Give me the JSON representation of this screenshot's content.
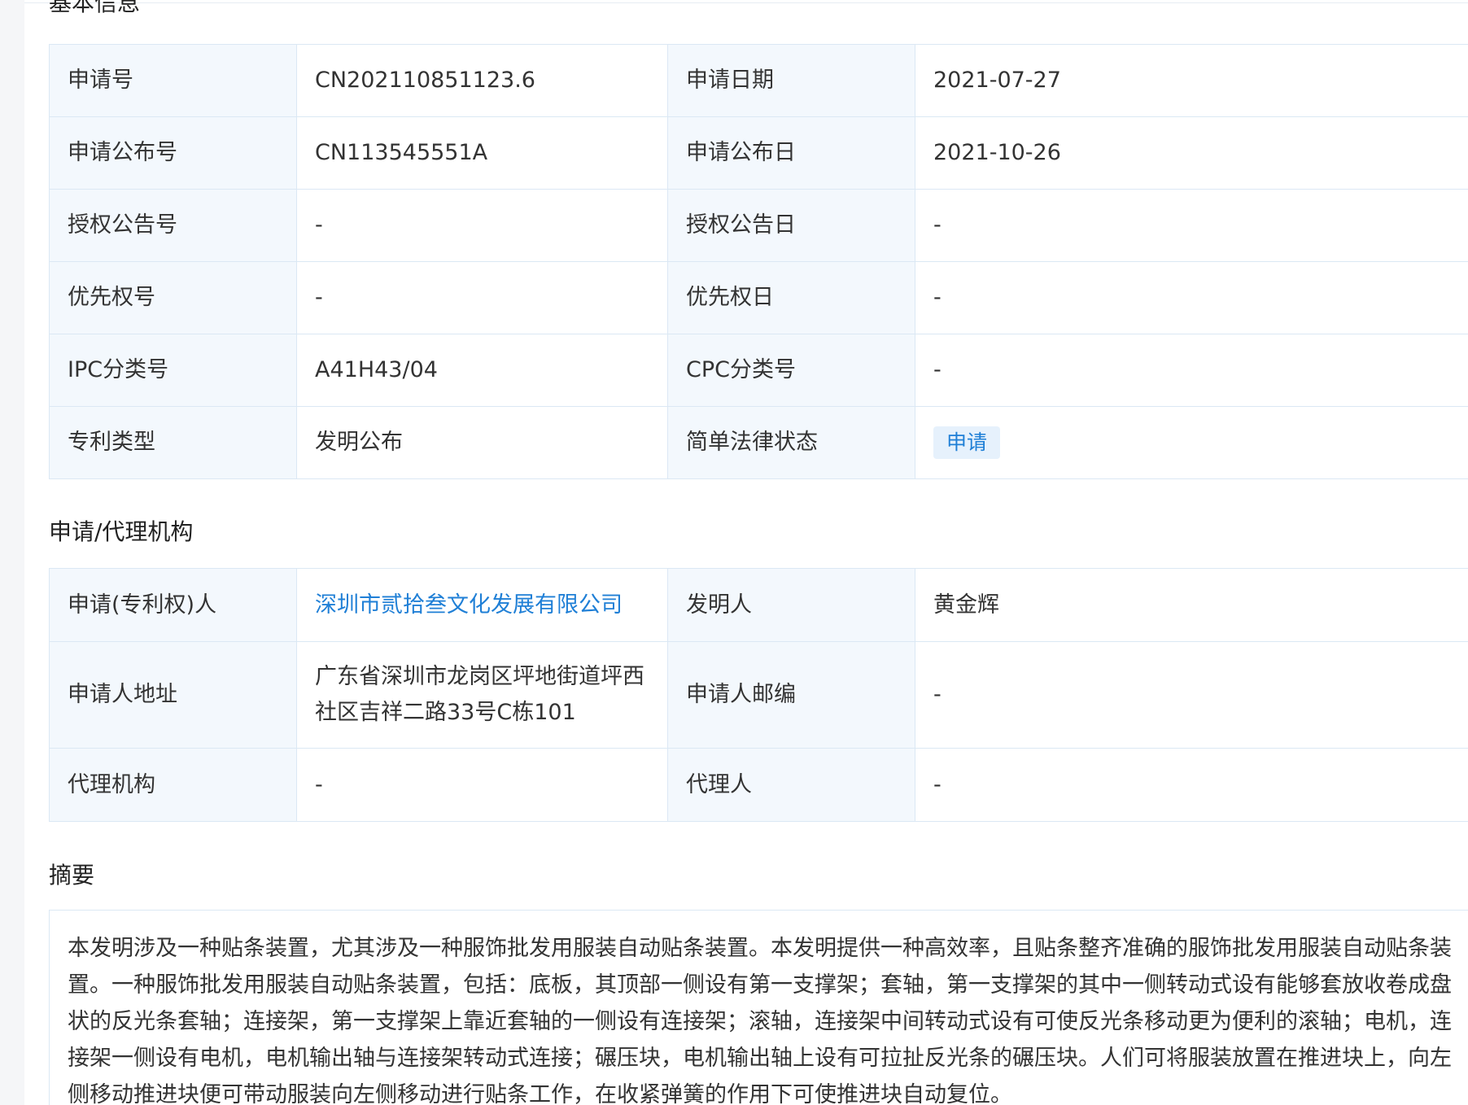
{
  "sections": {
    "basic": "基本信息",
    "agency": "申请/代理机构",
    "abstract": "摘要"
  },
  "basic_info": {
    "rows": [
      [
        "申请号",
        "CN202110851123.6",
        "申请日期",
        "2021-07-27"
      ],
      [
        "申请公布号",
        "CN113545551A",
        "申请公布日",
        "2021-10-26"
      ],
      [
        "授权公告号",
        "-",
        "授权公告日",
        "-"
      ],
      [
        "优先权号",
        "-",
        "优先权日",
        "-"
      ],
      [
        "IPC分类号",
        "A41H43/04",
        "CPC分类号",
        "-"
      ],
      [
        "专利类型",
        "发明公布",
        "简单法律状态",
        "申请"
      ]
    ]
  },
  "agency_info": {
    "rows": [
      [
        "申请(专利权)人",
        "深圳市贰拾叁文化发展有限公司",
        "发明人",
        "黄金辉"
      ],
      [
        "申请人地址",
        "广东省深圳市龙岗区坪地街道坪西社区吉祥二路33号C栋101",
        "申请人邮编",
        "-"
      ],
      [
        "代理机构",
        "-",
        "代理人",
        "-"
      ]
    ]
  },
  "abstract": {
    "text": "本发明涉及一种贴条装置，尤其涉及一种服饰批发用服装自动贴条装置。本发明提供一种高效率，且贴条整齐准确的服饰批发用服装自动贴条装置。一种服饰批发用服装自动贴条装置，包括：底板，其顶部一侧设有第一支撑架；套轴，第一支撑架的其中一侧转动式设有能够套放收卷成盘状的反光条套轴；连接架，第一支撑架上靠近套轴的一侧设有连接架；滚轴，连接架中间转动式设有可使反光条移动更为便利的滚轴；电机，连接架一侧设有电机，电机输出轴与连接架转动式连接；碾压块，电机输出轴上设有可拉扯反光条的碾压块。人们可将服装放置在推进块上，向左侧移动推进块便可带动服装向左侧移动进行贴条工作，在收紧弹簧的作用下可使推进块自动复位。"
  },
  "colors": {
    "key_cell_bg": "#f3f8fd",
    "border": "#dbe8f4",
    "link": "#1f7fd6",
    "badge_bg": "#e6f1fc"
  }
}
